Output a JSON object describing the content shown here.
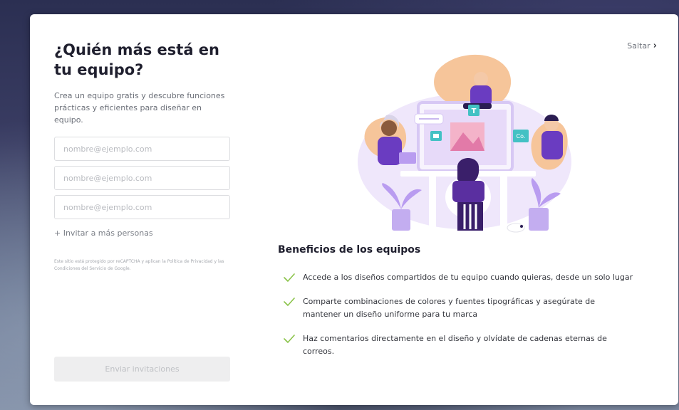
{
  "onboarding": {
    "title": "¿Quién más está en tu equipo?",
    "subtitle": "Crea un equipo gratis y descubre funciones prácticas y eficientes para diseñar en equipo.",
    "email_fields": [
      {
        "placeholder": "nombre@ejemplo.com",
        "value": ""
      },
      {
        "placeholder": "nombre@ejemplo.com",
        "value": ""
      },
      {
        "placeholder": "nombre@ejemplo.com",
        "value": ""
      }
    ],
    "invite_more_label": "+ Invitar a más personas",
    "recaptcha_notice": "Este sitio está protegido por reCAPTCHA y aplican la Política de Privacidad y las Condiciones del Servicio de Google.",
    "send_button_label": "Enviar invitaciones",
    "skip_label": "Saltar",
    "skip_icon": "chevron-right-icon"
  },
  "illustration": {
    "labels": {
      "t_badge": "T",
      "co_badge": "Co."
    }
  },
  "benefits": {
    "title": "Beneficios de los equipos",
    "check_icon": "check-icon",
    "check_color": "#8bc34a",
    "items": [
      "Accede a los diseños compartidos de tu equipo cuando quieras, desde un solo lugar",
      "Comparte combinaciones de colores y fuentes tipográficas y asegúrate de mantener un diseño uniforme para tu marca",
      "Haz comentarios directamente en el diseño y olvídate de cadenas eternas de correos."
    ]
  },
  "colors": {
    "accent_purple": "#7d2ae8",
    "teal": "#43c1c4",
    "peach": "#f3c08a"
  }
}
